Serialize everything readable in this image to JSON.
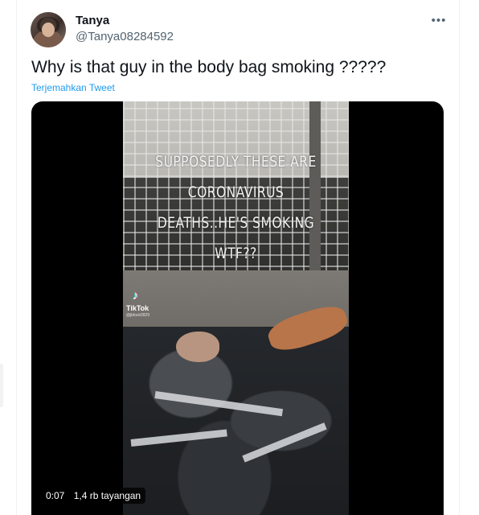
{
  "tweet": {
    "display_name": "Tanya",
    "handle": "@Tanya08284592",
    "more_icon_glyph": "•••",
    "text": "Why is that guy in the body bag smoking ?????",
    "translate_label": "Terjemahkan Tweet"
  },
  "video": {
    "overlay_lines": [
      "SUPPOSEDLY THESE ARE",
      "CORONAVIRUS",
      "DEATHS..HE'S SMOKING",
      "WTF??"
    ],
    "watermark_brand": "TikTok",
    "watermark_user": "@jblock0929",
    "duration": "0:07",
    "views": "1,4 rb tayangan"
  },
  "colors": {
    "link": "#1d9bf0",
    "text_primary": "#0f1419",
    "text_secondary": "#536471"
  },
  "icons": {
    "more": "more-horizontal-icon",
    "tiktok": "tiktok-logo-icon"
  }
}
